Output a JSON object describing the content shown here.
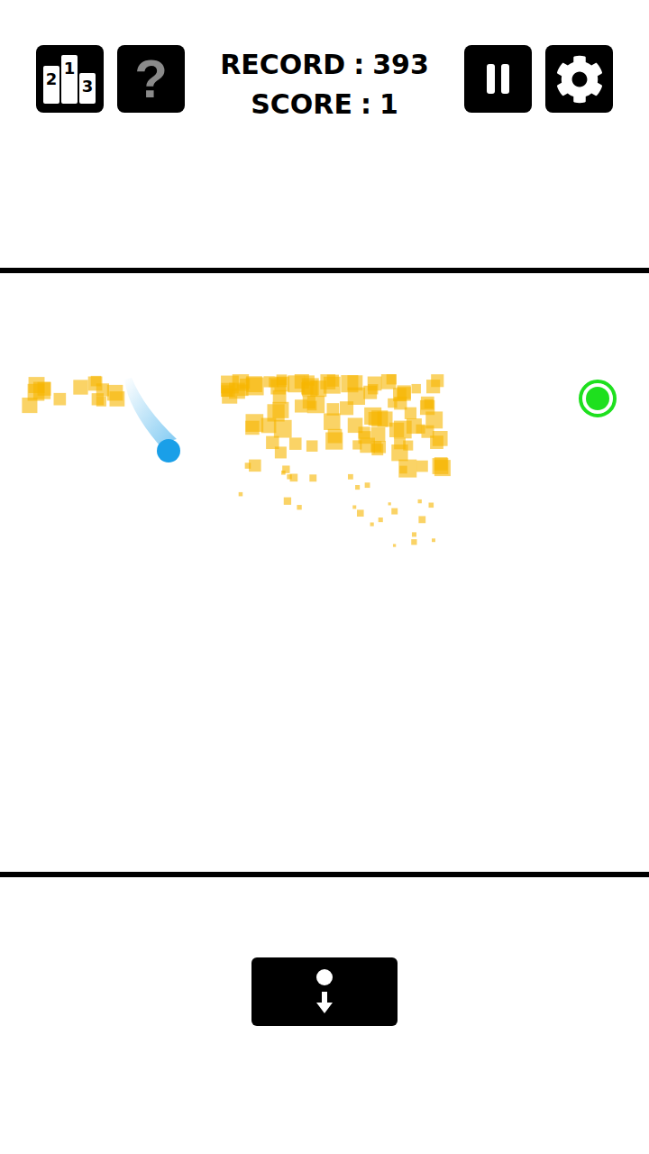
{
  "toolbar": {
    "leaderboard": {
      "places": [
        "2",
        "1",
        "3"
      ]
    },
    "help": {
      "glyph": "?"
    },
    "stats": [
      {
        "label": "RECORD",
        "separator": ":",
        "value": "393"
      },
      {
        "label": "SCORE",
        "separator": ":",
        "value": "1"
      }
    ]
  }
}
